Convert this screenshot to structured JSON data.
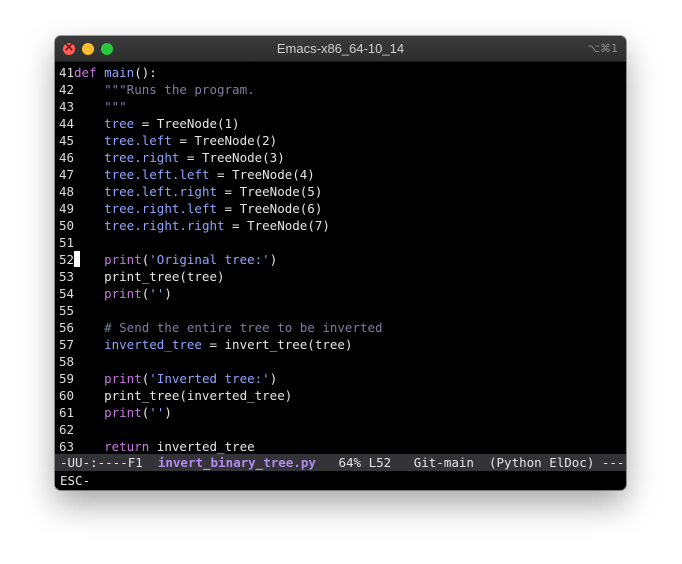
{
  "window": {
    "title": "Emacs-x86_64-10_14",
    "shortcut": "⌥⌘1"
  },
  "code_lines": [
    {
      "n": "41",
      "t": "def main():"
    },
    {
      "n": "42",
      "t": "    \"\"\"Runs the program."
    },
    {
      "n": "43",
      "t": "    \"\"\""
    },
    {
      "n": "44",
      "t": "    tree = TreeNode(1)"
    },
    {
      "n": "45",
      "t": "    tree.left = TreeNode(2)"
    },
    {
      "n": "46",
      "t": "    tree.right = TreeNode(3)"
    },
    {
      "n": "47",
      "t": "    tree.left.left = TreeNode(4)"
    },
    {
      "n": "48",
      "t": "    tree.left.right = TreeNode(5)"
    },
    {
      "n": "49",
      "t": "    tree.right.left = TreeNode(6)"
    },
    {
      "n": "50",
      "t": "    tree.right.right = TreeNode(7)"
    },
    {
      "n": "51",
      "t": ""
    },
    {
      "n": "52",
      "t": "    print('Original tree:')"
    },
    {
      "n": "53",
      "t": "    print_tree(tree)"
    },
    {
      "n": "54",
      "t": "    print('')"
    },
    {
      "n": "55",
      "t": ""
    },
    {
      "n": "56",
      "t": "    # Send the entire tree to be inverted"
    },
    {
      "n": "57",
      "t": "    inverted_tree = invert_tree(tree)"
    },
    {
      "n": "58",
      "t": ""
    },
    {
      "n": "59",
      "t": "    print('Inverted tree:')"
    },
    {
      "n": "60",
      "t": "    print_tree(inverted_tree)"
    },
    {
      "n": "61",
      "t": "    print('')"
    },
    {
      "n": "62",
      "t": ""
    },
    {
      "n": "63",
      "t": "    return inverted_tree"
    }
  ],
  "modeline": {
    "prefix": "-UU-:----F1  ",
    "filename": "invert_binary_tree.py",
    "position": "   64% L52   ",
    "vc": "Git-main  ",
    "modes": "(Python ElDoc) ---------"
  },
  "minibuffer": "ESC-",
  "colors": {
    "keyword": "#c577dd",
    "variable": "#8ea5ff",
    "comment": "#7a7fa0",
    "filename": "#b08cf0"
  }
}
